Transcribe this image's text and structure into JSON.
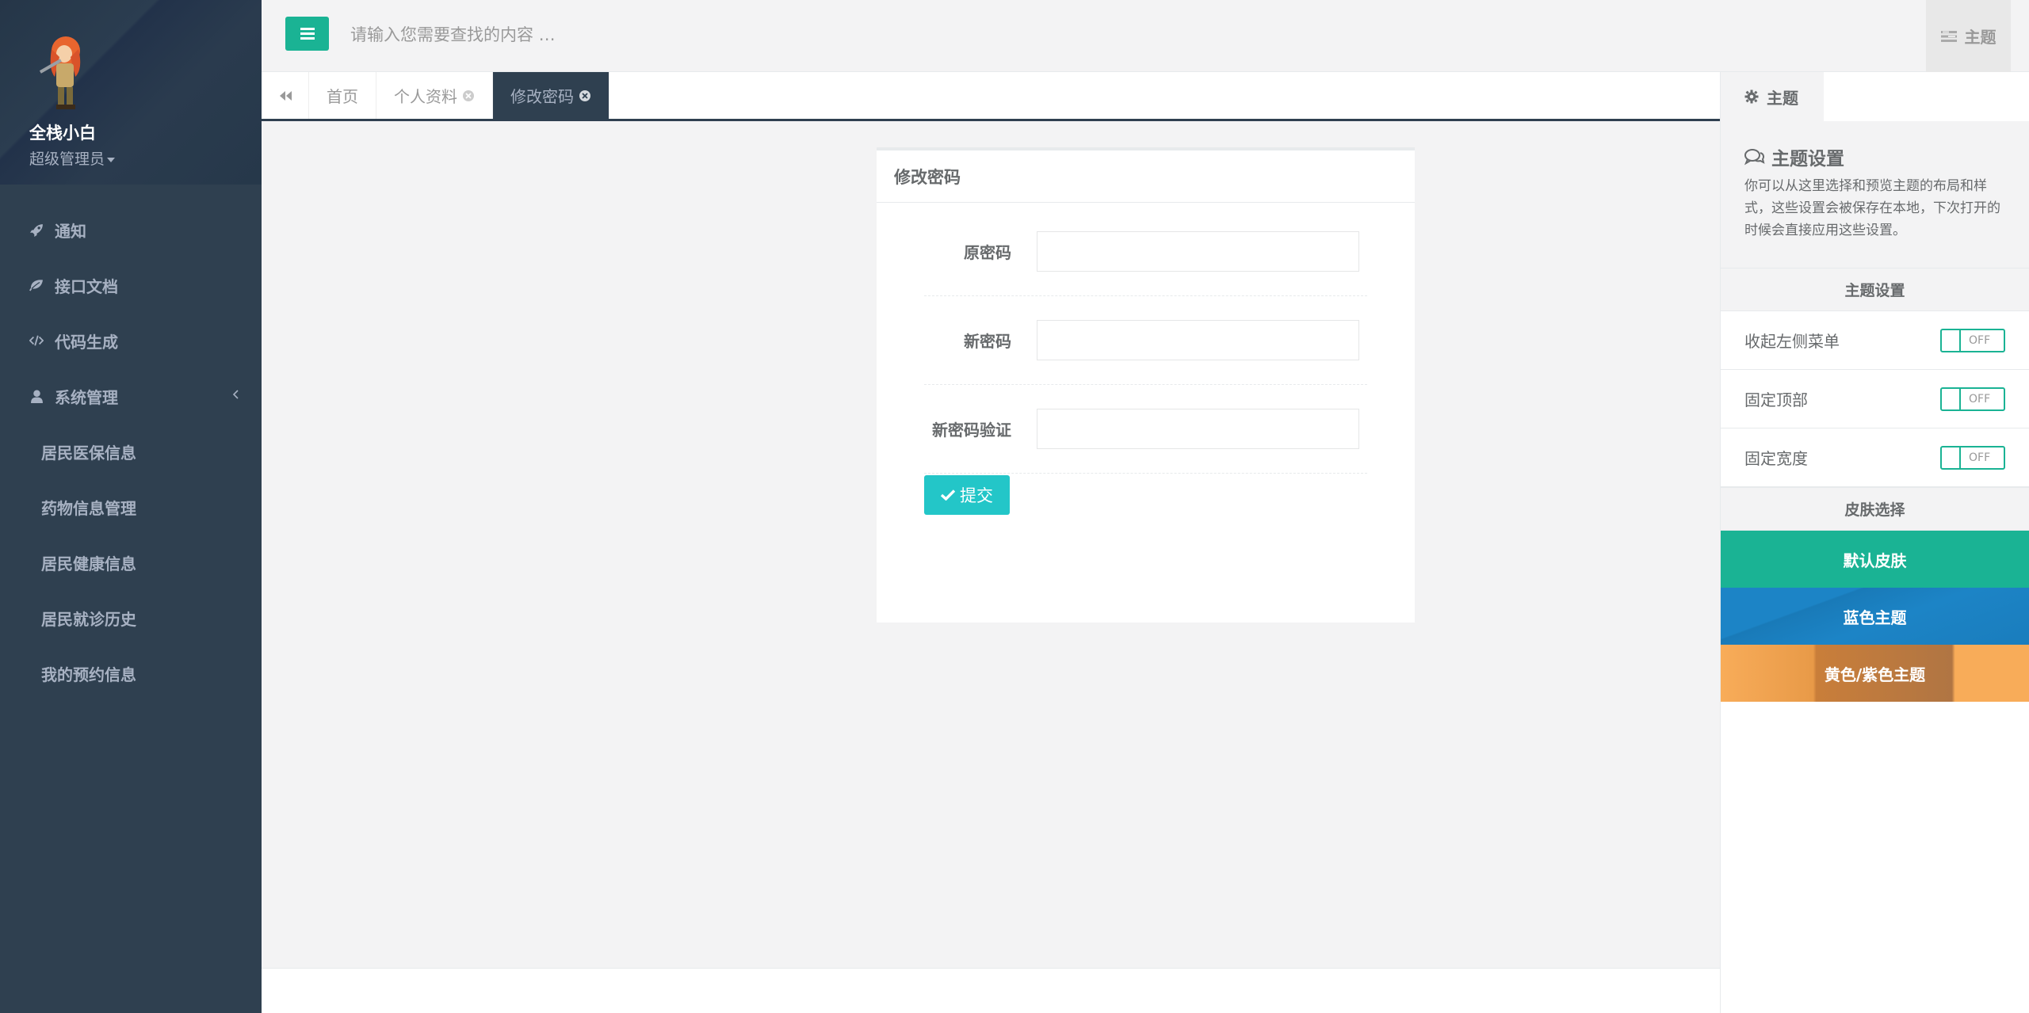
{
  "sidebar": {
    "username": "全栈小白",
    "role": "超级管理员",
    "items": [
      {
        "label": "通知",
        "icon": "rocket-icon"
      },
      {
        "label": "接口文档",
        "icon": "leaf-icon"
      },
      {
        "label": "代码生成",
        "icon": "code-icon"
      },
      {
        "label": "系统管理",
        "icon": "user-icon"
      }
    ],
    "subitems": [
      "居民医保信息",
      "药物信息管理",
      "居民健康信息",
      "居民就诊历史",
      "我的预约信息"
    ]
  },
  "topbar": {
    "search_placeholder": "请输入您需要查找的内容 …",
    "theme_label": "主题"
  },
  "tabs": {
    "items": [
      "首页",
      "个人资料",
      "修改密码"
    ]
  },
  "form": {
    "title": "修改密码",
    "old_password_label": "原密码",
    "new_password_label": "新密码",
    "confirm_password_label": "新密码验证",
    "submit_label": "提交"
  },
  "theme_panel": {
    "tab_label": "主题",
    "heading": "主题设置",
    "description": "你可以从这里选择和预览主题的布局和样式，这些设置会被保存在本地，下次打开的时候会直接应用这些设置。",
    "settings_header": "主题设置",
    "settings": [
      {
        "label": "收起左侧菜单",
        "state": "OFF"
      },
      {
        "label": "固定顶部",
        "state": "OFF"
      },
      {
        "label": "固定宽度",
        "state": "OFF"
      }
    ],
    "skin_header": "皮肤选择",
    "skins": [
      "默认皮肤",
      "蓝色主题",
      "黄色/紫色主题"
    ]
  },
  "colors": {
    "sidebar": "#2f4050",
    "accent": "#1ab394",
    "submit": "#23c6c8",
    "blue_skin": "#1c84c6",
    "yellow_skin": "#f8ac59"
  }
}
